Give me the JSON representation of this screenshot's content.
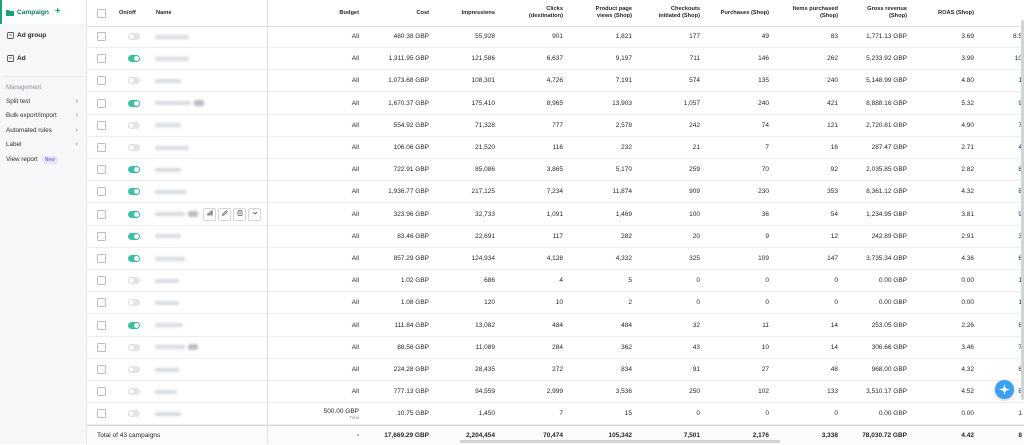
{
  "sidebar": {
    "levels": [
      {
        "label": "Campaign",
        "active": true
      },
      {
        "label": "Ad group",
        "active": false
      },
      {
        "label": "Ad",
        "active": false
      }
    ],
    "management_heading": "Management",
    "links": [
      {
        "label": "Split test",
        "chevron": true
      },
      {
        "label": "Bulk export/import",
        "chevron": true
      },
      {
        "label": "Automated rules",
        "chevron": true
      },
      {
        "label": "Label",
        "chevron": true
      },
      {
        "label": "View report",
        "chevron": false,
        "badge": "New"
      }
    ]
  },
  "table": {
    "headers": {
      "onoff": "On/off",
      "name": "Name",
      "budget": "Budget",
      "cost": "Cost",
      "impressions": "Impressions",
      "clicks": "Clicks (destination)",
      "ppv": "Product page views (Shop)",
      "checkouts": "Checkouts initiated (Shop)",
      "purchases": "Purchases (Shop)",
      "items": "Items purchased (Shop)",
      "revenue": "Gross revenue (Shop)",
      "roas": "ROAS (Shop)"
    },
    "rows": [
      {
        "on": false,
        "budget": "All",
        "cost": "480.38 GBP",
        "impressions": "55,928",
        "clicks": "901",
        "ppv": "1,821",
        "checkouts": "177",
        "purchases": "49",
        "items": "83",
        "revenue": "1,771.13 GBP",
        "roas": "3.69",
        "extra": "8.5"
      },
      {
        "on": true,
        "budget": "All",
        "cost": "1,311.95 GBP",
        "impressions": "121,586",
        "clicks": "6,637",
        "ppv": "9,197",
        "checkouts": "711",
        "purchases": "146",
        "items": "262",
        "revenue": "5,233.92 GBP",
        "roas": "3.99",
        "extra": "10"
      },
      {
        "on": false,
        "budget": "All",
        "cost": "1,073.68 GBP",
        "impressions": "108,301",
        "clicks": "4,726",
        "ppv": "7,191",
        "checkouts": "574",
        "purchases": "135",
        "items": "240",
        "revenue": "5,148.99 GBP",
        "roas": "4.80",
        "extra": "1"
      },
      {
        "on": true,
        "budget": "All",
        "cost": "1,670.37 GBP",
        "impressions": "175,410",
        "clicks": "8,965",
        "ppv": "13,903",
        "checkouts": "1,057",
        "purchases": "240",
        "items": "421",
        "revenue": "8,888.16 GBP",
        "roas": "5.32",
        "extra": "9"
      },
      {
        "on": false,
        "budget": "All",
        "cost": "554.92 GBP",
        "impressions": "71,328",
        "clicks": "777",
        "ppv": "2,578",
        "checkouts": "242",
        "purchases": "74",
        "items": "121",
        "revenue": "2,720.81 GBP",
        "roas": "4.90",
        "extra": "7"
      },
      {
        "on": false,
        "budget": "All",
        "cost": "106.06 GBP",
        "impressions": "21,520",
        "clicks": "116",
        "ppv": "232",
        "checkouts": "21",
        "purchases": "7",
        "items": "16",
        "revenue": "287.47 GBP",
        "roas": "2.71",
        "extra": "4"
      },
      {
        "on": true,
        "budget": "All",
        "cost": "722.91 GBP",
        "impressions": "85,086",
        "clicks": "3,865",
        "ppv": "5,170",
        "checkouts": "259",
        "purchases": "70",
        "items": "92",
        "revenue": "2,035.85 GBP",
        "roas": "2.82",
        "extra": "8"
      },
      {
        "on": true,
        "budget": "All",
        "cost": "1,936.77 GBP",
        "impressions": "217,125",
        "clicks": "7,234",
        "ppv": "11,874",
        "checkouts": "909",
        "purchases": "230",
        "items": "353",
        "revenue": "8,361.12 GBP",
        "roas": "4.32",
        "extra": "8"
      },
      {
        "on": true,
        "budget": "All",
        "cost": "323.96 GBP",
        "impressions": "32,733",
        "clicks": "1,091",
        "ppv": "1,469",
        "checkouts": "100",
        "purchases": "36",
        "items": "54",
        "revenue": "1,234.95 GBP",
        "roas": "3.81",
        "extra": "9",
        "tools": true
      },
      {
        "on": true,
        "budget": "All",
        "cost": "83.46 GBP",
        "impressions": "22,691",
        "clicks": "117",
        "ppv": "282",
        "checkouts": "20",
        "purchases": "9",
        "items": "12",
        "revenue": "242.89 GBP",
        "roas": "2.91",
        "extra": "3"
      },
      {
        "on": true,
        "budget": "All",
        "cost": "857.29 GBP",
        "impressions": "124,934",
        "clicks": "4,128",
        "ppv": "4,332",
        "checkouts": "325",
        "purchases": "109",
        "items": "147",
        "revenue": "3,735.34 GBP",
        "roas": "4.36",
        "extra": "6"
      },
      {
        "on": false,
        "budget": "All",
        "cost": "1.02 GBP",
        "impressions": "686",
        "clicks": "4",
        "ppv": "5",
        "checkouts": "0",
        "purchases": "0",
        "items": "0",
        "revenue": "0.00 GBP",
        "roas": "0.00",
        "extra": "1"
      },
      {
        "on": false,
        "budget": "All",
        "cost": "1.08 GBP",
        "impressions": "120",
        "clicks": "10",
        "ppv": "2",
        "checkouts": "0",
        "purchases": "0",
        "items": "0",
        "revenue": "0.00 GBP",
        "roas": "0.00",
        "extra": "1"
      },
      {
        "on": true,
        "budget": "All",
        "cost": "111.84 GBP",
        "impressions": "13,082",
        "clicks": "484",
        "ppv": "484",
        "checkouts": "32",
        "purchases": "11",
        "items": "14",
        "revenue": "253.05 GBP",
        "roas": "2.26",
        "extra": "8"
      },
      {
        "on": false,
        "budget": "All",
        "cost": "88.56 GBP",
        "impressions": "11,089",
        "clicks": "284",
        "ppv": "362",
        "checkouts": "43",
        "purchases": "10",
        "items": "14",
        "revenue": "306.66 GBP",
        "roas": "3.46",
        "extra": "7"
      },
      {
        "on": false,
        "budget": "All",
        "cost": "224.28 GBP",
        "impressions": "28,435",
        "clicks": "272",
        "ppv": "834",
        "checkouts": "91",
        "purchases": "27",
        "items": "48",
        "revenue": "968.00 GBP",
        "roas": "4.32",
        "extra": "8"
      },
      {
        "on": false,
        "budget": "All",
        "cost": "777.13 GBP",
        "impressions": "94,559",
        "clicks": "2,999",
        "ppv": "3,536",
        "checkouts": "250",
        "purchases": "102",
        "items": "133",
        "revenue": "3,510.17 GBP",
        "roas": "4.52",
        "extra": "8"
      },
      {
        "on": false,
        "budget": "500.00 GBP",
        "budget_sub": "Total",
        "cost": "10.75 GBP",
        "impressions": "1,450",
        "clicks": "7",
        "ppv": "15",
        "checkouts": "0",
        "purchases": "0",
        "items": "0",
        "revenue": "0.00 GBP",
        "roas": "0.00",
        "extra": "1"
      }
    ],
    "total": {
      "label": "Total of 43 campaigns",
      "budget": "-",
      "cost": "17,669.29 GBP",
      "impressions": "2,204,454",
      "clicks": "70,474",
      "ppv": "105,342",
      "checkouts": "7,501",
      "purchases": "2,176",
      "items": "3,338",
      "revenue": "78,030.72 GBP",
      "roas": "4.42",
      "extra": "8"
    }
  },
  "colors": {
    "accent": "#1aa27d",
    "toggle_on": "#3cc1a6",
    "assistant": "#3aa0f0"
  },
  "icons": {
    "campaign": "folder-icon",
    "add": "plus-icon",
    "assistant": "sparkle-icon"
  }
}
